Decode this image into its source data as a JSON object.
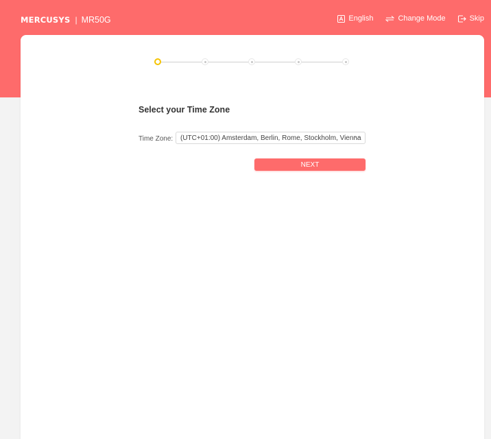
{
  "header": {
    "brand_logo": "MERCUSYS",
    "brand_separator": "|",
    "model": "MR50G",
    "actions": [
      {
        "label": "English",
        "icon": "language-icon"
      },
      {
        "label": "Change Mode",
        "icon": "change-mode-icon"
      },
      {
        "label": "Skip",
        "icon": "skip-icon"
      }
    ]
  },
  "stepper": {
    "total_steps": 5,
    "current_step": 1
  },
  "main": {
    "title": "Select your Time Zone",
    "timezone_label": "Time Zone:",
    "timezone_value": "(UTC+01:00) Amsterdam, Berlin, Rome, Stockholm, Vienna",
    "next_label": "NEXT"
  },
  "colors": {
    "brand": "#fe6b6b",
    "active_step": "#f5c300",
    "page_background": "#f3f3f3"
  }
}
